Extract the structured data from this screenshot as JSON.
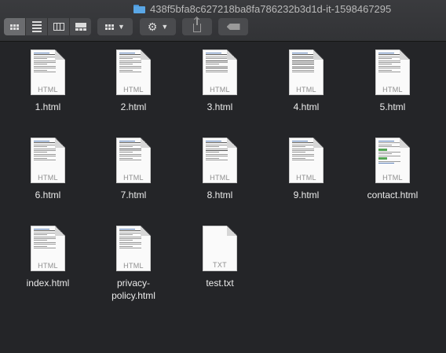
{
  "window": {
    "title": "438f5bfa8c627218ba8fa786232b3d1d-it-1598467295"
  },
  "toolbar": {
    "view_buttons": [
      "icon-view",
      "list-view",
      "column-view",
      "gallery-view"
    ],
    "active_view": "icon-view",
    "group_icon": "group-grid-icon",
    "action_icon": "gear-icon",
    "share_icon": "share-icon",
    "tag_icon": "tag-icon"
  },
  "files": [
    {
      "name": "1.html",
      "type": "HTML"
    },
    {
      "name": "2.html",
      "type": "HTML"
    },
    {
      "name": "3.html",
      "type": "HTML"
    },
    {
      "name": "4.html",
      "type": "HTML"
    },
    {
      "name": "5.html",
      "type": "HTML"
    },
    {
      "name": "6.html",
      "type": "HTML"
    },
    {
      "name": "7.html",
      "type": "HTML"
    },
    {
      "name": "8.html",
      "type": "HTML"
    },
    {
      "name": "9.html",
      "type": "HTML"
    },
    {
      "name": "contact.html",
      "type": "HTML"
    },
    {
      "name": "index.html",
      "type": "HTML"
    },
    {
      "name": "privacy-\npolicy.html",
      "type": "HTML"
    },
    {
      "name": "test.txt",
      "type": "TXT"
    }
  ]
}
